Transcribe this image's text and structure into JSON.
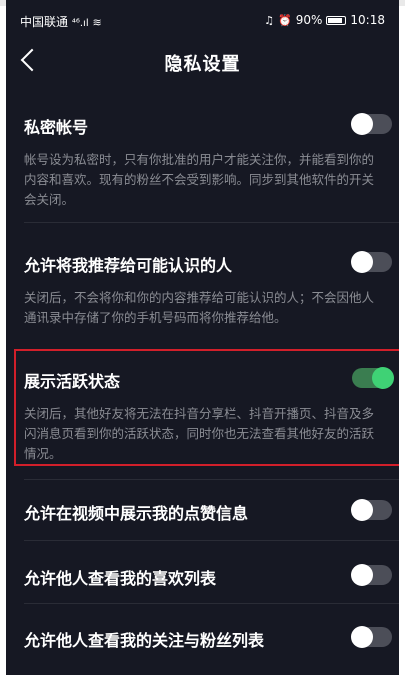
{
  "status_bar": {
    "carrier": "中国联通",
    "signal": "⁴⁶.ıl",
    "battery": "90%",
    "battery_level": 0.9,
    "time": "10:18"
  },
  "nav": {
    "title": "隐私设置",
    "back_icon": "chevron-left-icon"
  },
  "settings": [
    {
      "title": "私密帐号",
      "desc": "帐号设为私密时，只有你批准的用户才能关注你，并能看到你的内容和喜欢。现有的粉丝不会受到影响。同步到其他软件的开关会关闭。",
      "enabled": false
    },
    {
      "title": "允许将我推荐给可能认识的人",
      "desc": "关闭后，不会将你和你的内容推荐给可能认识的人；不会因他人通讯录中存储了你的手机号码而将你推荐给他。",
      "enabled": false
    },
    {
      "title": "展示活跃状态",
      "desc": "关闭后，其他好友将无法在抖音分享栏、抖音开播页、抖音及多闪消息页看到你的活跃状态，同时你也无法查看其他好友的活跃情况。",
      "enabled": true
    },
    {
      "title": "允许在视频中展示我的点赞信息",
      "enabled": false
    },
    {
      "title": "允许他人查看我的喜欢列表",
      "enabled": false
    },
    {
      "title": "允许他人查看我的关注与粉丝列表",
      "enabled": false
    }
  ],
  "colors": {
    "background": "#161823",
    "toggle_on": "#3fd275",
    "highlight_border": "#d21f2a"
  }
}
